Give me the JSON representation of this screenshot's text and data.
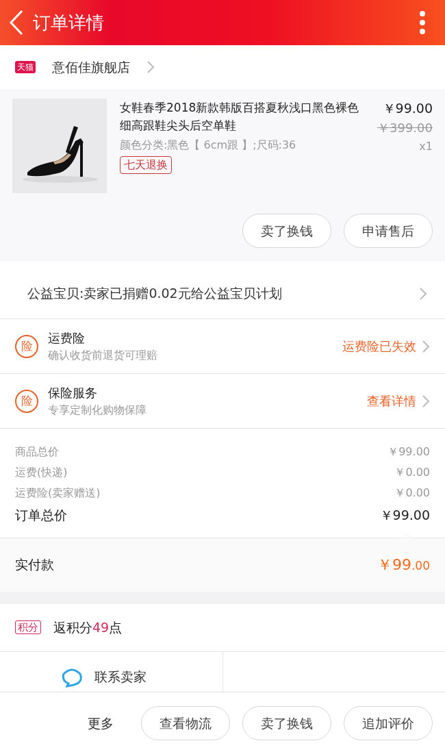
{
  "header": {
    "title": "订单详情"
  },
  "shop": {
    "badge": "天猫",
    "name": "意佰佳旗舰店"
  },
  "product": {
    "title": "女鞋春季2018新款韩版百搭夏秋浅口黑色裸色细高跟鞋尖头后空单鞋",
    "spec": "颜色分类:黑色【 6cm跟 】;尺码:36",
    "tag": "七天退换",
    "price": "￥99.00",
    "original_price": "￥399.00",
    "quantity": "x1",
    "buttons": [
      "卖了换钱",
      "申请售后"
    ]
  },
  "charity": {
    "text": "公益宝贝:卖家已捐赠0.02元给公益宝贝计划"
  },
  "services": [
    {
      "badge": "险",
      "title": "运费险",
      "subtitle": "确认收货前退货可理赔",
      "action": "运费险已失效"
    },
    {
      "badge": "险",
      "title": "保险服务",
      "subtitle": "专享定制化购物保障",
      "action": "查看详情"
    }
  ],
  "totals": [
    {
      "kind": "minor",
      "label": "商品总价",
      "value": "￥99.00"
    },
    {
      "kind": "minor",
      "label": "运费(快递)",
      "value": "￥0.00"
    },
    {
      "kind": "minor",
      "label": "运费险(卖家赠送)",
      "value": "￥0.00"
    },
    {
      "kind": "total",
      "label": "订单总价",
      "value": "￥99.00"
    }
  ],
  "paid": {
    "label": "实付款",
    "amount": "￥99",
    "cents": ".00"
  },
  "points": {
    "badge": "积分",
    "before": "返积分",
    "number": "49",
    "after": "点"
  },
  "contact": {
    "label": "联系卖家"
  },
  "bottom_bar": {
    "more": "更多",
    "buttons": [
      "查看物流",
      "卖了换钱",
      "追加评价"
    ]
  }
}
